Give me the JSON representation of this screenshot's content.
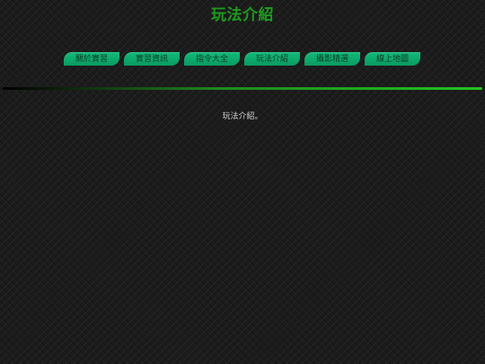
{
  "header": {
    "title": "玩法介紹"
  },
  "nav": {
    "items": [
      {
        "label": "關於實習"
      },
      {
        "label": "實習資訊"
      },
      {
        "label": "指令大全"
      },
      {
        "label": "玩法介紹"
      },
      {
        "label": "攝影精選"
      },
      {
        "label": "線上地圖"
      }
    ]
  },
  "main": {
    "text": "玩法介紹。"
  },
  "colors": {
    "title": "#1f9a1f",
    "nav_button": "#0fa86d",
    "divider_accent": "#22c322"
  }
}
